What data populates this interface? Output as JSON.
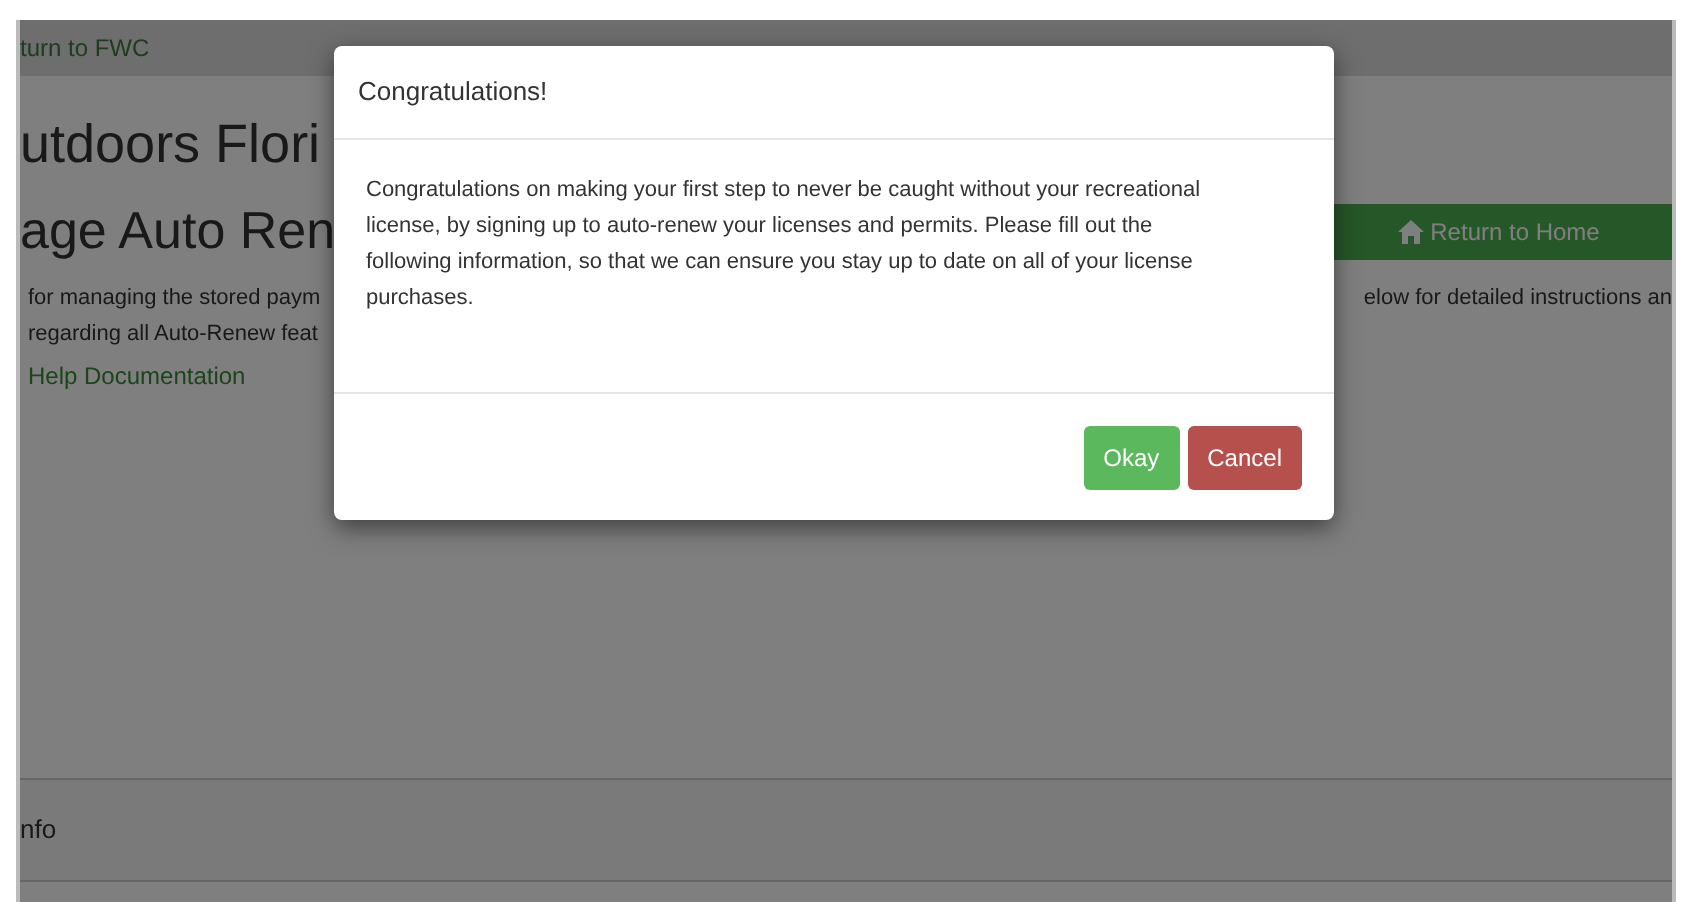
{
  "top_bar": {
    "link": "turn to FWC"
  },
  "page": {
    "site_title": "utdoors Flori",
    "heading": "age Auto Ren",
    "home_button": "Return to Home",
    "intro_left": [
      "for managing the stored paym",
      "regarding all Auto-Renew feat"
    ],
    "intro_right": "elow for detailed instructions an",
    "help_link": "Help Documentation",
    "section_title": "nfo"
  },
  "dialog": {
    "title": "Congratulations!",
    "message": "Congratulations on making your first step to never be caught without your recreational license, by signing up to auto-renew your licenses and permits. Please fill out the following information, so that we can ensure you stay up to date on all of your license purchases.",
    "buttons": [
      {
        "label": "Okay",
        "kind": "confirm"
      },
      {
        "label": "Cancel",
        "kind": "cancel"
      }
    ]
  }
}
